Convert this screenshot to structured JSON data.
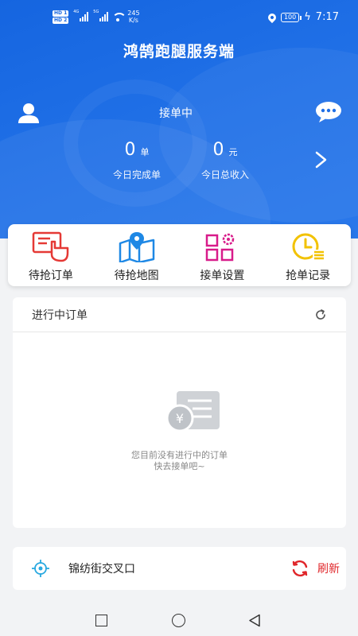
{
  "status_bar": {
    "hd1": "HD 1",
    "hd2": "HD 2",
    "sig1_type": "4G",
    "sig2_type": "5G",
    "speed_value": "245",
    "speed_unit": "K/s",
    "battery": "100",
    "time": "7:17"
  },
  "app": {
    "title": "鸿鹄跑腿服务端"
  },
  "header": {
    "status_label": "接单中",
    "completed_count": "0",
    "completed_unit": "单",
    "completed_label": "今日完成单",
    "income_value": "0",
    "income_unit": "元",
    "income_label": "今日总收入"
  },
  "quick_actions": [
    {
      "label": "待抢订单",
      "icon": "hand-order-icon",
      "color": "#e53935"
    },
    {
      "label": "待抢地图",
      "icon": "map-icon",
      "color": "#1e88e5"
    },
    {
      "label": "接单设置",
      "icon": "settings-grid-icon",
      "color": "#d81b8a"
    },
    {
      "label": "抢单记录",
      "icon": "clock-record-icon",
      "color": "#f2c200"
    }
  ],
  "orders": {
    "title": "进行中订单",
    "empty_line1": "您目前没有进行中的订单",
    "empty_line2": "快去接单吧~"
  },
  "location": {
    "address": "锦纺街交叉口",
    "refresh_label": "刷新"
  },
  "colors": {
    "header_blue": "#1565e0",
    "refresh_red": "#e0262a"
  }
}
